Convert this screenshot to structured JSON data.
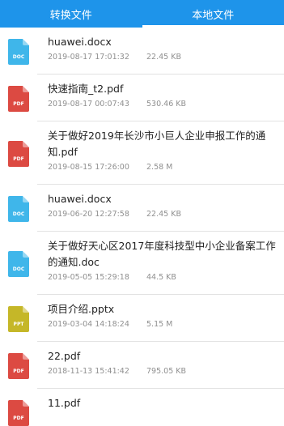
{
  "tabs": [
    {
      "label": "转换文件",
      "active": false
    },
    {
      "label": "本地文件",
      "active": true
    }
  ],
  "colors": {
    "header": "#1e94ea",
    "doc": "#3fb6ea",
    "pdf": "#dc4a42",
    "ppt": "#c5b728"
  },
  "files": [
    {
      "name": "huawei.docx",
      "date": "2019-08-17 17:01:32",
      "size": "22.45 KB",
      "type": "DOC",
      "icon": "doc-file-icon"
    },
    {
      "name": "快速指南_t2.pdf",
      "date": "2019-08-17 00:07:43",
      "size": "530.46 KB",
      "type": "PDF",
      "icon": "pdf-file-icon"
    },
    {
      "name": "关于做好2019年长沙市小巨人企业申报工作的通知.pdf",
      "date": "2019-08-15 17:26:00",
      "size": "2.58 M",
      "type": "PDF",
      "icon": "pdf-file-icon"
    },
    {
      "name": "huawei.docx",
      "date": "2019-06-20 12:27:58",
      "size": "22.45 KB",
      "type": "DOC",
      "icon": "doc-file-icon"
    },
    {
      "name": "关于做好天心区2017年度科技型中小企业备案工作的通知.doc",
      "date": "2019-05-05 15:29:18",
      "size": "44.5 KB",
      "type": "DOC",
      "icon": "doc-file-icon"
    },
    {
      "name": "项目介绍.pptx",
      "date": "2019-03-04 14:18:24",
      "size": "5.15 M",
      "type": "PPT",
      "icon": "ppt-file-icon"
    },
    {
      "name": "22.pdf",
      "date": "2018-11-13 15:41:42",
      "size": "795.05 KB",
      "type": "PDF",
      "icon": "pdf-file-icon"
    },
    {
      "name": "11.pdf",
      "date": "",
      "size": "",
      "type": "PDF",
      "icon": "pdf-file-icon"
    }
  ]
}
